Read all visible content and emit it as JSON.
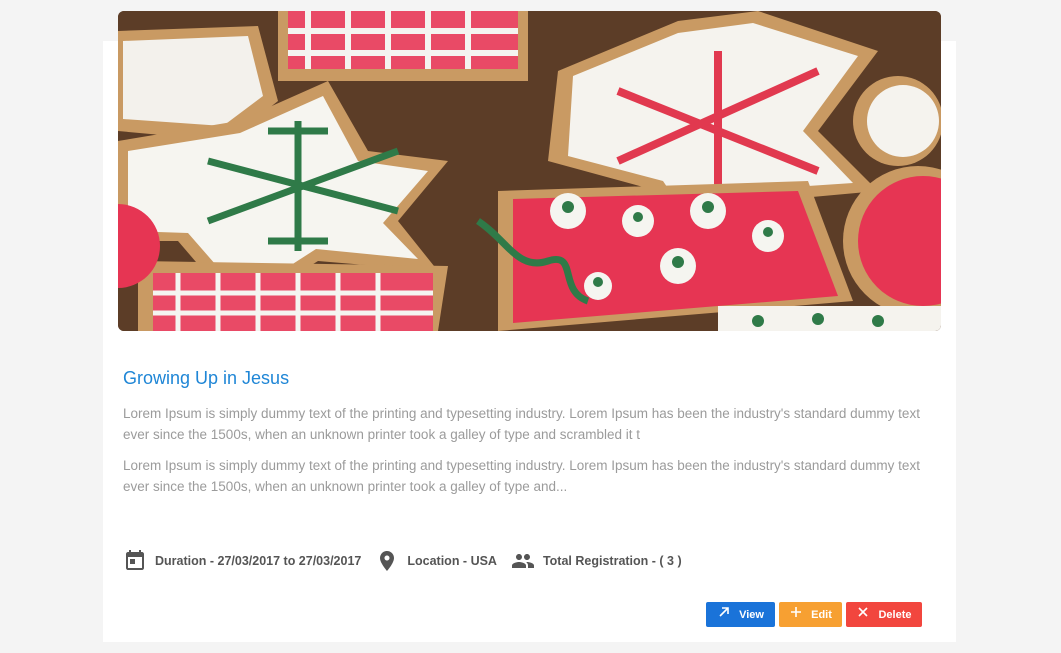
{
  "event": {
    "title": "Growing Up in Jesus",
    "paragraphs": [
      "Lorem Ipsum is simply dummy text of the printing and typesetting industry. Lorem Ipsum has been the industry's standard dummy text ever since the 1500s, when an unknown printer took a galley of type and scrambled it t",
      "Lorem Ipsum is simply dummy text of the printing and typesetting industry. Lorem Ipsum has been the industry's standard dummy text ever since the 1500s, when an unknown printer took a galley of type and..."
    ],
    "duration": "Duration - 27/03/2017 to 27/03/2017",
    "location": "Location - USA",
    "registrations": "Total Registration - ( 3 )"
  },
  "actions": {
    "view_label": "View",
    "edit_label": "Edit",
    "delete_label": "Delete"
  },
  "icons": {
    "duration": "calendar-icon",
    "location": "location-pin-icon",
    "registrations": "people-icon",
    "view": "arrow-up-right-icon",
    "edit": "plus-icon",
    "delete": "close-icon"
  },
  "colors": {
    "title": "#1f86d6",
    "view": "#1a73d9",
    "edit": "#f7a032",
    "delete": "#f2463e"
  }
}
